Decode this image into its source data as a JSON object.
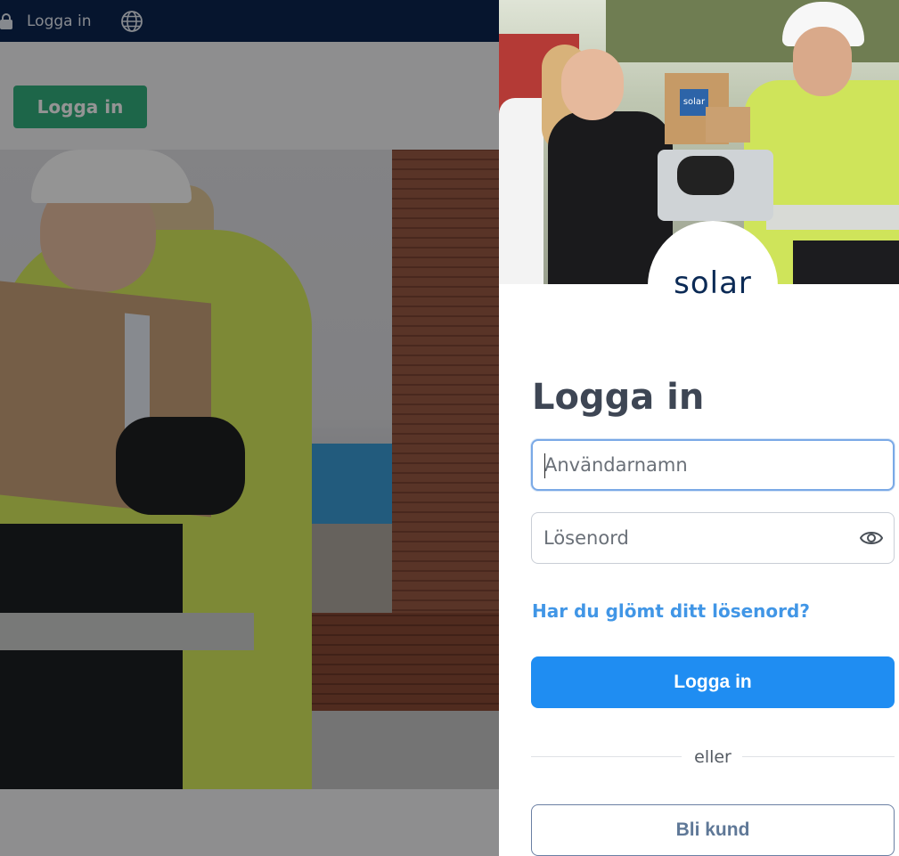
{
  "background_page": {
    "topbar": {
      "login_link": "Logga in",
      "icons": [
        "lock-icon",
        "globe-icon"
      ]
    },
    "login_button": "Logga in",
    "hero_image": "worker-with-box-photo"
  },
  "login_panel": {
    "header_image": "solar-delivery-photo",
    "bag_label": "solar",
    "logo_text": "solar",
    "title": "Logga in",
    "username": {
      "value": "",
      "placeholder": "Användarnamn"
    },
    "password": {
      "value": "",
      "placeholder": "Lösenord",
      "toggle_icon": "eye-icon"
    },
    "forgot_link": "Har du glömt ditt lösenord?",
    "submit_label": "Logga in",
    "divider_text": "eller",
    "become_customer_label": "Bli kund"
  },
  "colors": {
    "topbar": "#0b2550",
    "green_button": "#33b07f",
    "primary": "#1f8df2",
    "link": "#4196e6",
    "title": "#3e4654",
    "logo": "#0b2a55"
  }
}
